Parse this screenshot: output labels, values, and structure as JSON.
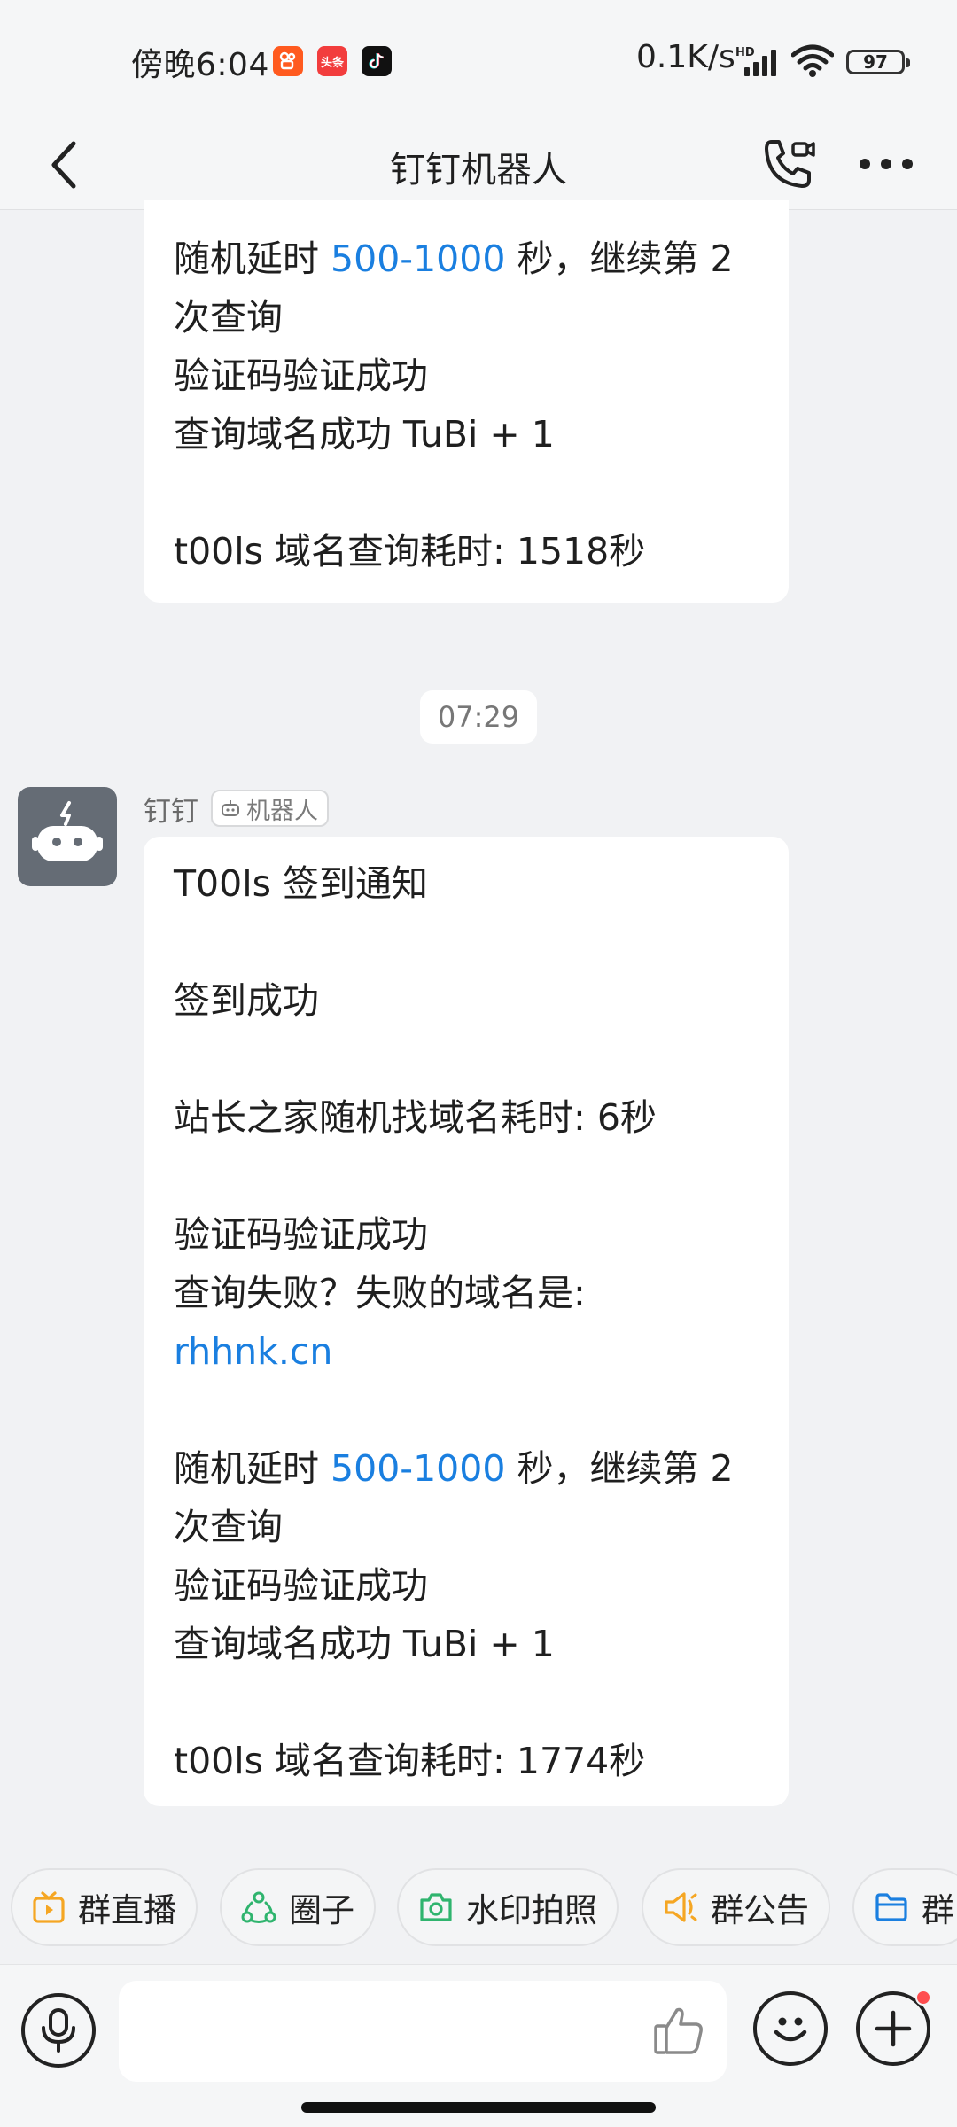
{
  "status_bar": {
    "time": "傍晚6:04",
    "app_icons": [
      {
        "name": "kuaishou-icon",
        "color": "#ff5a1f",
        "glyph": "☐"
      },
      {
        "name": "toutiao-icon",
        "color": "#f23d3d",
        "glyph": "头条"
      },
      {
        "name": "douyin-icon",
        "color": "#111111",
        "glyph": "♪"
      }
    ],
    "network_speed": "0.1K/s",
    "hd_label": "HD",
    "battery": "97"
  },
  "header": {
    "title": "钉钉机器人"
  },
  "messages": {
    "previous_bubble": {
      "lines": [
        {
          "pre": "随机延时 ",
          "highlight": "500-1000",
          "post": " 秒，继续第 2"
        },
        {
          "pre": "次查询",
          "highlight": "",
          "post": ""
        },
        {
          "pre": "验证码验证成功",
          "highlight": "",
          "post": ""
        },
        {
          "pre": "查询域名成功 TuBi + 1",
          "highlight": "",
          "post": ""
        },
        {
          "pre": "",
          "highlight": "",
          "post": ""
        },
        {
          "pre": "t00ls 域名查询耗时: 1518秒",
          "highlight": "",
          "post": ""
        }
      ]
    },
    "timestamp": "07:29",
    "sender": {
      "name": "钉钉",
      "badge": "机器人"
    },
    "main_bubble": {
      "lines": [
        {
          "pre": "T00ls 签到通知",
          "highlight": "",
          "post": ""
        },
        {
          "pre": "",
          "highlight": "",
          "post": ""
        },
        {
          "pre": "签到成功",
          "highlight": "",
          "post": ""
        },
        {
          "pre": "",
          "highlight": "",
          "post": ""
        },
        {
          "pre": "站长之家随机找域名耗时: 6秒",
          "highlight": "",
          "post": ""
        },
        {
          "pre": "",
          "highlight": "",
          "post": ""
        },
        {
          "pre": "验证码验证成功",
          "highlight": "",
          "post": ""
        },
        {
          "pre": "查询失败？失败的域名是:",
          "highlight": "",
          "post": ""
        },
        {
          "pre": "",
          "highlight": "rhhnk.cn",
          "post": ""
        },
        {
          "pre": "",
          "highlight": "",
          "post": ""
        },
        {
          "pre": "随机延时 ",
          "highlight": "500-1000",
          "post": " 秒，继续第 2"
        },
        {
          "pre": "次查询",
          "highlight": "",
          "post": ""
        },
        {
          "pre": "验证码验证成功",
          "highlight": "",
          "post": ""
        },
        {
          "pre": "查询域名成功 TuBi + 1",
          "highlight": "",
          "post": ""
        },
        {
          "pre": "",
          "highlight": "",
          "post": ""
        },
        {
          "pre": "t00ls 域名查询耗时: 1774秒",
          "highlight": "",
          "post": ""
        }
      ]
    },
    "link_color": "#1a7fe0"
  },
  "quick_actions": [
    {
      "label": "群直播",
      "icon": "live-tv-icon",
      "color": "#f5a623"
    },
    {
      "label": "圈子",
      "icon": "circle-group-icon",
      "color": "#2fb46e"
    },
    {
      "label": "水印拍照",
      "icon": "camera-icon",
      "color": "#2fb46e"
    },
    {
      "label": "群公告",
      "icon": "megaphone-icon",
      "color": "#f5a623"
    },
    {
      "label": "群",
      "icon": "folder-icon",
      "color": "#1a7fe0"
    }
  ],
  "input_bar": {
    "placeholder": ""
  }
}
